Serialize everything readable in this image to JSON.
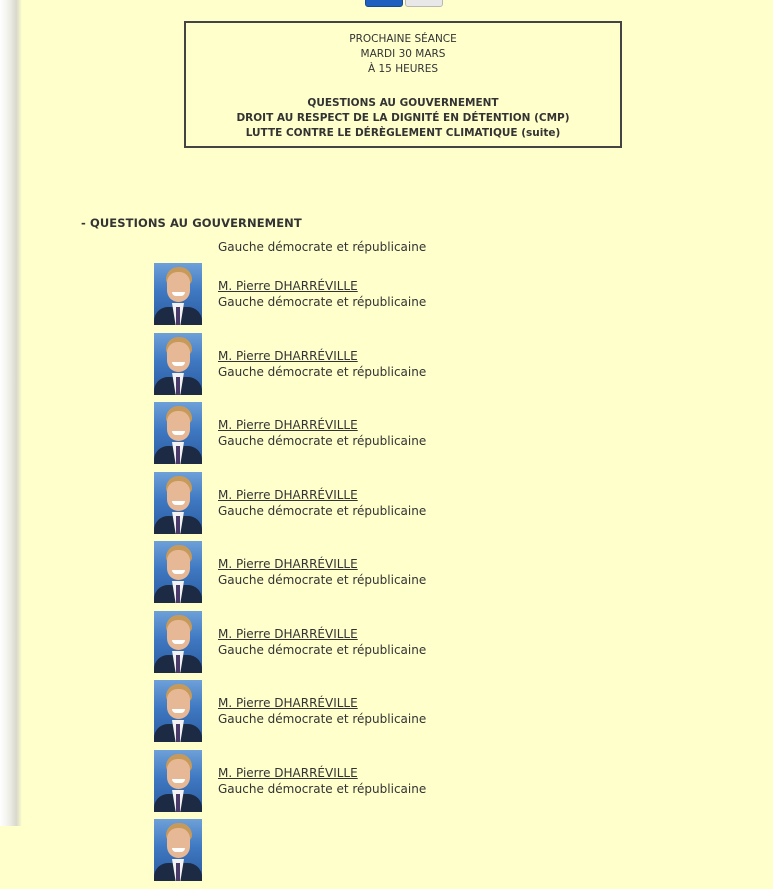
{
  "seance": {
    "label": "PROCHAINE SÉANCE",
    "date": "MARDI 30 MARS",
    "time": "À 15 HEURES",
    "agenda": [
      "QUESTIONS AU GOUVERNEMENT",
      "DROIT AU RESPECT DE LA DIGNITÉ EN DÉTENTION (CMP)",
      "LUTTE CONTRE LE DÉRÈGLEMENT CLIMATIQUE (suite)"
    ]
  },
  "section": {
    "heading": "- QUESTIONS AU GOUVERNEMENT",
    "first_group": "Gauche démocrate et républicaine"
  },
  "speakers": [
    {
      "name": "M. Pierre DHARRÉVILLE",
      "group": "Gauche démocrate et républicaine",
      "photo_icon": "deputy-portrait"
    },
    {
      "name": "M. Pierre DHARRÉVILLE",
      "group": "Gauche démocrate et républicaine",
      "photo_icon": "deputy-portrait"
    },
    {
      "name": "M. Pierre DHARRÉVILLE",
      "group": "Gauche démocrate et républicaine",
      "photo_icon": "deputy-portrait"
    },
    {
      "name": "M. Pierre DHARRÉVILLE",
      "group": "Gauche démocrate et républicaine",
      "photo_icon": "deputy-portrait"
    },
    {
      "name": "M. Pierre DHARRÉVILLE",
      "group": "Gauche démocrate et républicaine",
      "photo_icon": "deputy-portrait"
    },
    {
      "name": "M. Pierre DHARRÉVILLE",
      "group": "Gauche démocrate et républicaine",
      "photo_icon": "deputy-portrait"
    },
    {
      "name": "M. Pierre DHARRÉVILLE",
      "group": "Gauche démocrate et républicaine",
      "photo_icon": "deputy-portrait"
    },
    {
      "name": "M. Pierre DHARRÉVILLE",
      "group": "Gauche démocrate et républicaine",
      "photo_icon": "deputy-portrait"
    },
    {
      "name": "",
      "group": "",
      "photo_icon": "deputy-portrait"
    }
  ],
  "colors": {
    "page_background": "#ffffcc",
    "text": "#333333",
    "box_border": "#444444",
    "primary_button": "#1f5fbf"
  }
}
